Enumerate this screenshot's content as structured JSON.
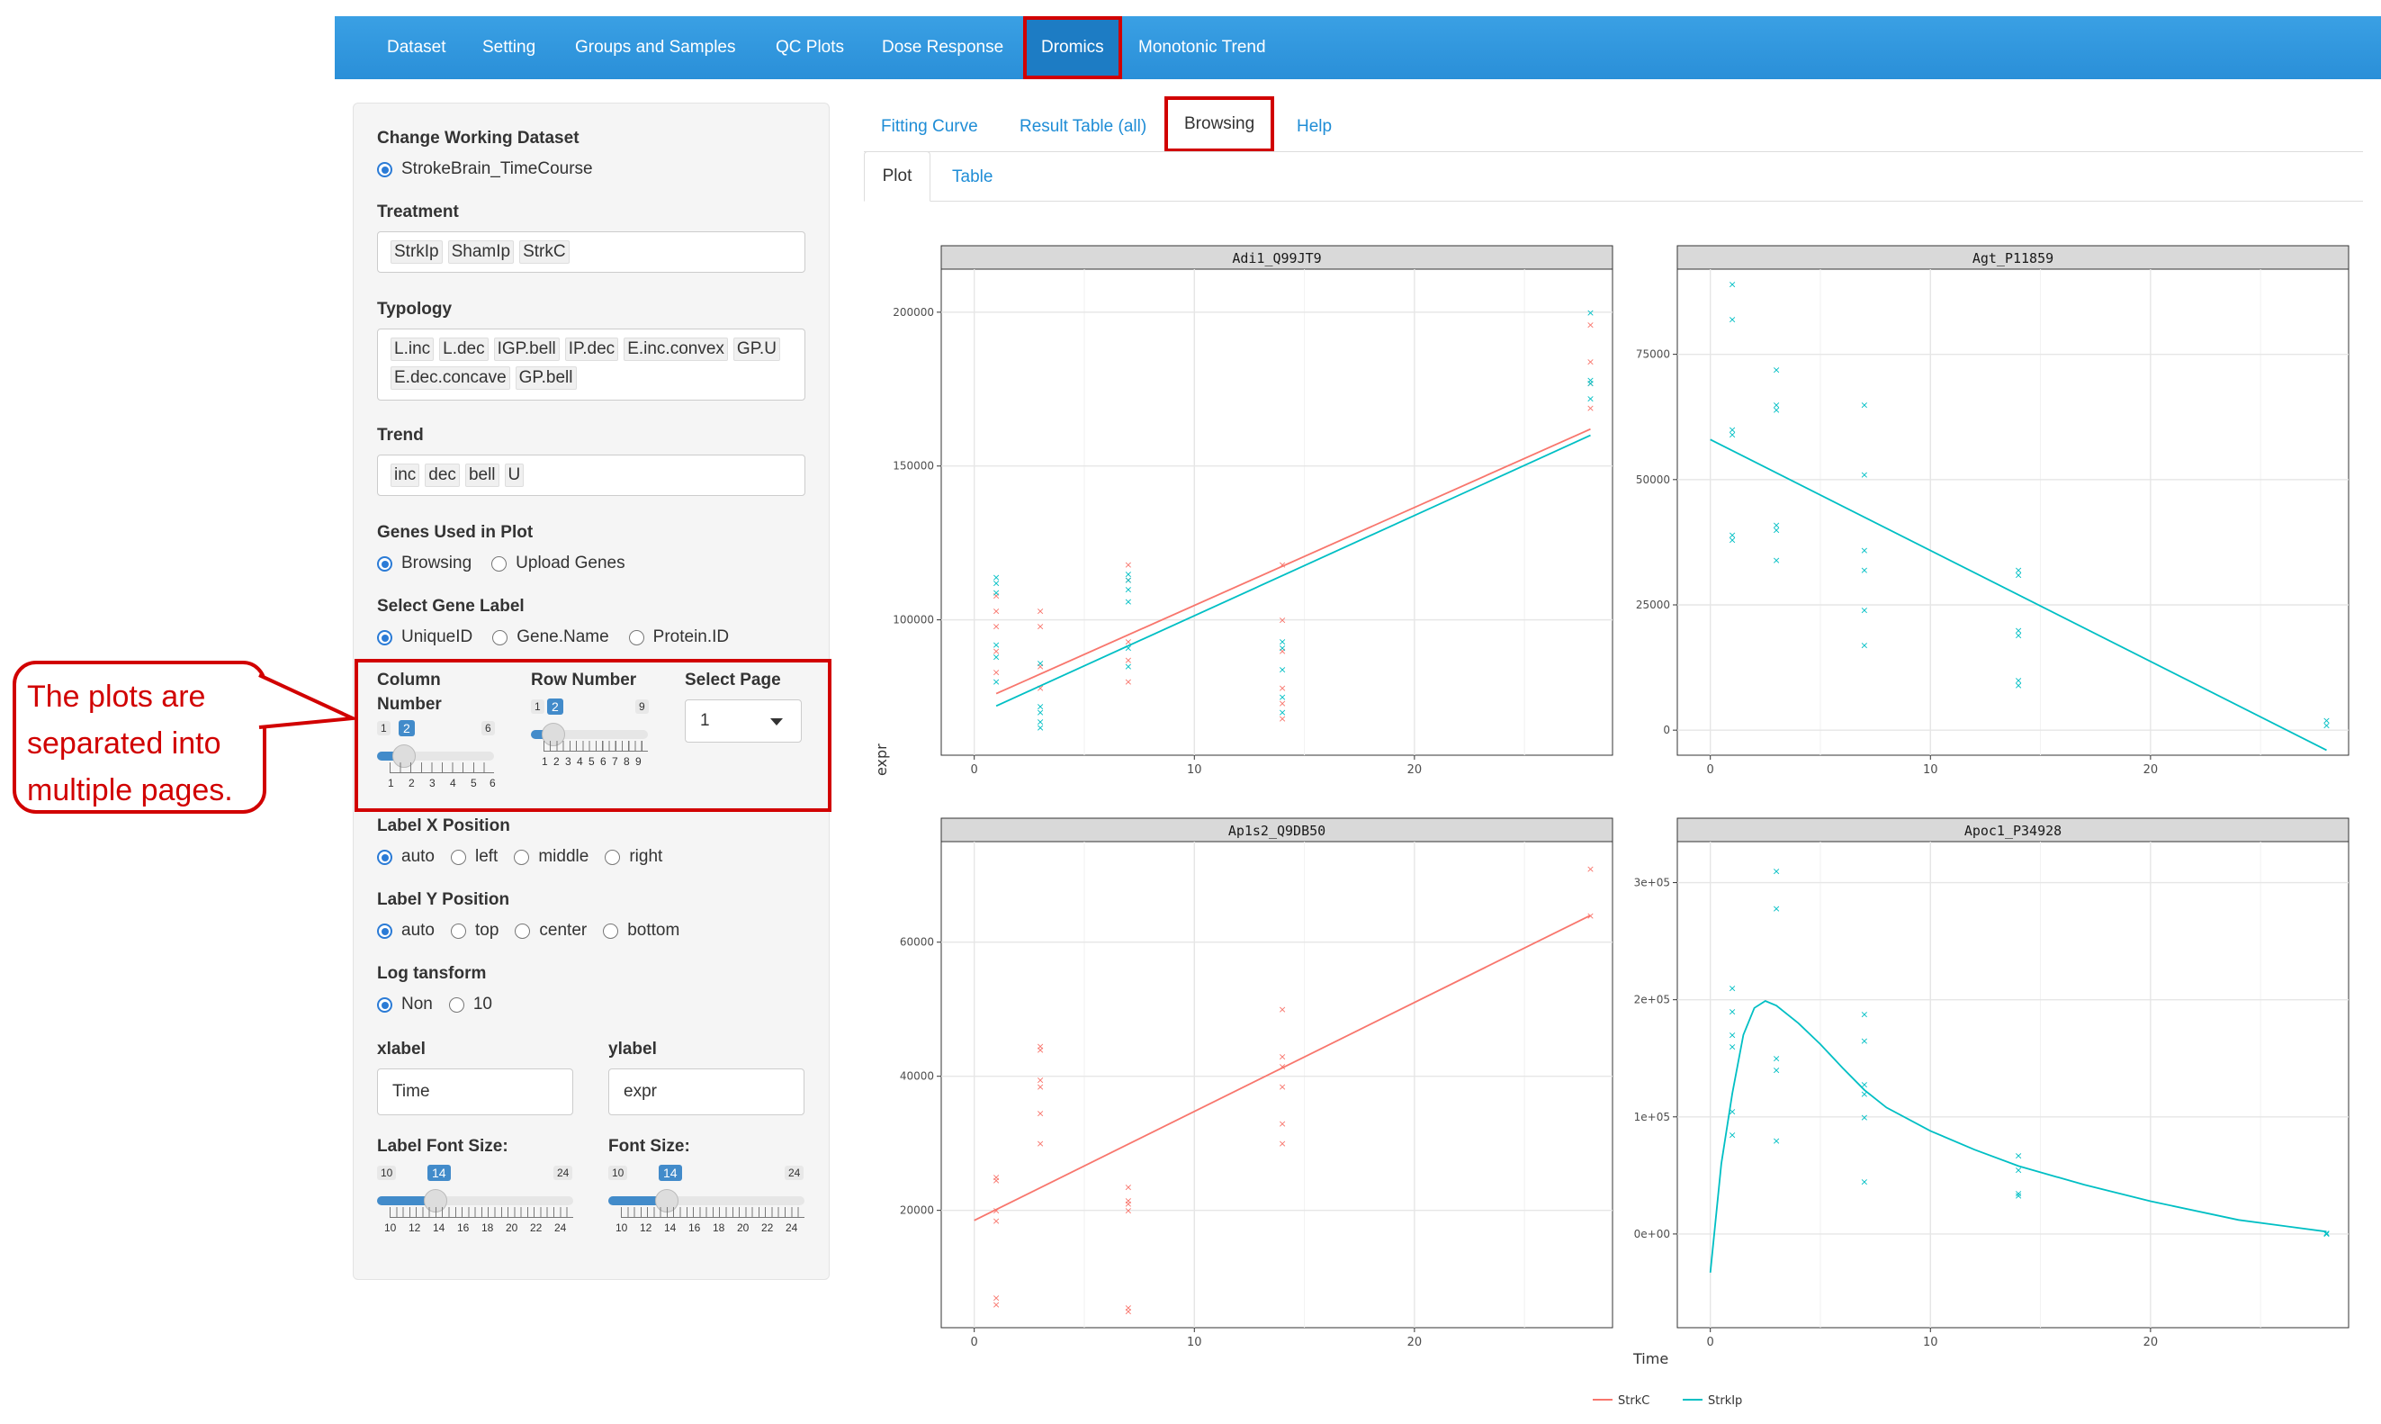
{
  "nav": {
    "items": [
      "Dataset",
      "Setting",
      "Groups and Samples",
      "QC Plots",
      "Dose Response",
      "Dromics",
      "Monotonic Trend"
    ],
    "active": "Dromics"
  },
  "sidebar": {
    "working_dataset": {
      "label": "Change Working Dataset",
      "option": "StrokeBrain_TimeCourse"
    },
    "treatment": {
      "label": "Treatment",
      "tags": [
        "StrkIp",
        "ShamIp",
        "StrkC"
      ]
    },
    "typology": {
      "label": "Typology",
      "tags": [
        "L.inc",
        "L.dec",
        "IGP.bell",
        "IP.dec",
        "E.inc.convex",
        "GP.U",
        "E.dec.concave",
        "GP.bell"
      ]
    },
    "trend": {
      "label": "Trend",
      "tags": [
        "inc",
        "dec",
        "bell",
        "U"
      ]
    },
    "genes_used": {
      "label": "Genes Used in Plot",
      "options": [
        "Browsing",
        "Upload Genes"
      ],
      "selected": "Browsing"
    },
    "gene_label": {
      "label": "Select Gene Label",
      "options": [
        "UniqueID",
        "Gene.Name",
        "Protein.ID"
      ],
      "selected": "UniqueID"
    },
    "column_number": {
      "label_line1": "Column",
      "label_line2": "Number",
      "min": "1",
      "max": "6",
      "value": "2",
      "ticks": [
        "1",
        "2",
        "3",
        "4",
        "5",
        "6"
      ]
    },
    "row_number": {
      "label": "Row Number",
      "min": "1",
      "max": "9",
      "value": "2",
      "ticks": [
        "1",
        "2",
        "3",
        "4",
        "5",
        "6",
        "7",
        "8",
        "9"
      ]
    },
    "select_page": {
      "label": "Select Page",
      "value": "1"
    },
    "label_x": {
      "label": "Label X Position",
      "options": [
        "auto",
        "left",
        "middle",
        "right"
      ],
      "selected": "auto"
    },
    "label_y": {
      "label": "Label Y Position",
      "options": [
        "auto",
        "top",
        "center",
        "bottom"
      ],
      "selected": "auto"
    },
    "log": {
      "label": "Log tansform",
      "options": [
        "Non",
        "10"
      ],
      "selected": "Non"
    },
    "xlabel": {
      "label": "xlabel",
      "value": "Time"
    },
    "ylabel": {
      "label": "ylabel",
      "value": "expr"
    },
    "label_font": {
      "label": "Label Font Size:",
      "min": "10",
      "max": "24",
      "value": "14",
      "ticks": [
        "10",
        "12",
        "14",
        "16",
        "18",
        "20",
        "22",
        "24"
      ]
    },
    "font_size": {
      "label": "Font Size:",
      "min": "10",
      "max": "24",
      "value": "14",
      "ticks": [
        "10",
        "12",
        "14",
        "16",
        "18",
        "20",
        "22",
        "24"
      ]
    }
  },
  "callout": {
    "text": [
      "The plots are",
      "separated into",
      "multiple pages."
    ]
  },
  "tabs": {
    "items": [
      "Fitting Curve",
      "Result Table (all)",
      "Browsing",
      "Help"
    ],
    "active": "Browsing"
  },
  "subtabs": {
    "items": [
      "Plot",
      "Table"
    ],
    "active": "Plot"
  },
  "chart_data": {
    "type": "scatter",
    "xlabel": "Time",
    "ylabel": "expr",
    "legend": {
      "placement": "bottom",
      "entries": [
        "StrkC",
        "StrkIp"
      ]
    },
    "colors": {
      "StrkC": "#f8766d",
      "StrkIp": "#00bfc4"
    },
    "x_ticks": [
      0,
      10,
      20
    ],
    "xlim": [
      -1.5,
      29
    ],
    "panels": [
      {
        "title": "Adi1_Q99JT9",
        "ylim": [
          56000,
          214000
        ],
        "y_ticks": [
          {
            "v": 100000,
            "l": "100000"
          },
          {
            "v": 150000,
            "l": "150000"
          },
          {
            "v": 200000,
            "l": "200000"
          }
        ],
        "series": [
          {
            "name": "StrkC",
            "points": [
              [
                1,
                83000
              ],
              [
                1,
                90000
              ],
              [
                1,
                98000
              ],
              [
                1,
                103000
              ],
              [
                1,
                108000
              ],
              [
                3,
                78000
              ],
              [
                3,
                85000
              ],
              [
                3,
                98000
              ],
              [
                3,
                103000
              ],
              [
                7,
                80000
              ],
              [
                7,
                87000
              ],
              [
                7,
                93000
              ],
              [
                7,
                113000
              ],
              [
                7,
                118000
              ],
              [
                14,
                68000
              ],
              [
                14,
                73000
              ],
              [
                14,
                78000
              ],
              [
                14,
                90000
              ],
              [
                14,
                100000
              ],
              [
                14,
                118000
              ],
              [
                28,
                169000
              ],
              [
                28,
                177000
              ],
              [
                28,
                184000
              ],
              [
                28,
                196000
              ]
            ],
            "fit": [
              [
                1,
                76000
              ],
              [
                28,
                162000
              ]
            ]
          },
          {
            "name": "StrkIp",
            "points": [
              [
                1,
                80000
              ],
              [
                1,
                88000
              ],
              [
                1,
                92000
              ],
              [
                1,
                109000
              ],
              [
                1,
                112000
              ],
              [
                1,
                114000
              ],
              [
                3,
                65000
              ],
              [
                3,
                67000
              ],
              [
                3,
                70000
              ],
              [
                3,
                72000
              ],
              [
                3,
                86000
              ],
              [
                7,
                85000
              ],
              [
                7,
                91000
              ],
              [
                7,
                106000
              ],
              [
                7,
                110000
              ],
              [
                7,
                113000
              ],
              [
                7,
                115000
              ],
              [
                14,
                70000
              ],
              [
                14,
                75000
              ],
              [
                14,
                84000
              ],
              [
                14,
                91000
              ],
              [
                14,
                93000
              ],
              [
                28,
                172000
              ],
              [
                28,
                177000
              ],
              [
                28,
                178000
              ],
              [
                28,
                200000
              ]
            ],
            "fit": [
              [
                1,
                72000
              ],
              [
                28,
                160000
              ]
            ]
          }
        ]
      },
      {
        "title": "Agt_P11859",
        "ylim": [
          -5000,
          92000
        ],
        "y_ticks": [
          {
            "v": 0,
            "l": "0"
          },
          {
            "v": 25000,
            "l": "25000"
          },
          {
            "v": 50000,
            "l": "50000"
          },
          {
            "v": 75000,
            "l": "75000"
          }
        ],
        "series": [
          {
            "name": "StrkIp",
            "points": [
              [
                1,
                89000
              ],
              [
                1,
                82000
              ],
              [
                1,
                60000
              ],
              [
                1,
                59000
              ],
              [
                1,
                39000
              ],
              [
                1,
                38000
              ],
              [
                3,
                72000
              ],
              [
                3,
                65000
              ],
              [
                3,
                64000
              ],
              [
                3,
                41000
              ],
              [
                3,
                40000
              ],
              [
                3,
                34000
              ],
              [
                7,
                65000
              ],
              [
                7,
                51000
              ],
              [
                7,
                36000
              ],
              [
                7,
                32000
              ],
              [
                7,
                24000
              ],
              [
                7,
                17000
              ],
              [
                14,
                32000
              ],
              [
                14,
                31000
              ],
              [
                14,
                20000
              ],
              [
                14,
                19000
              ],
              [
                14,
                10000
              ],
              [
                14,
                9000
              ],
              [
                28,
                2000
              ],
              [
                28,
                1000
              ]
            ],
            "fit": [
              [
                0,
                58000
              ],
              [
                28,
                -4000
              ]
            ]
          }
        ]
      },
      {
        "title": "Ap1s2_Q9DB50",
        "ylim": [
          2500,
          75000
        ],
        "y_ticks": [
          {
            "v": 20000,
            "l": "20000"
          },
          {
            "v": 40000,
            "l": "40000"
          },
          {
            "v": 60000,
            "l": "60000"
          }
        ],
        "series": [
          {
            "name": "StrkC",
            "points": [
              [
                1,
                25000
              ],
              [
                1,
                24500
              ],
              [
                1,
                20000
              ],
              [
                1,
                18500
              ],
              [
                1,
                7000
              ],
              [
                1,
                6000
              ],
              [
                3,
                44500
              ],
              [
                3,
                44000
              ],
              [
                3,
                39500
              ],
              [
                3,
                38500
              ],
              [
                3,
                34500
              ],
              [
                3,
                30000
              ],
              [
                7,
                23500
              ],
              [
                7,
                21500
              ],
              [
                7,
                21000
              ],
              [
                7,
                20000
              ],
              [
                7,
                5500
              ],
              [
                7,
                5000
              ],
              [
                14,
                50000
              ],
              [
                14,
                43000
              ],
              [
                14,
                41500
              ],
              [
                14,
                38500
              ],
              [
                14,
                33000
              ],
              [
                14,
                30000
              ],
              [
                28,
                71000
              ],
              [
                28,
                64000
              ]
            ],
            "fit": [
              [
                0,
                18500
              ],
              [
                28,
                64000
              ]
            ]
          }
        ]
      },
      {
        "title": "Apoc1_P34928",
        "ylim": [
          -80000,
          335000
        ],
        "y_ticks": [
          {
            "v": 0,
            "l": "0e+00"
          },
          {
            "v": 100000,
            "l": "1e+05"
          },
          {
            "v": 200000,
            "l": "2e+05"
          },
          {
            "v": 300000,
            "l": "3e+05"
          }
        ],
        "series": [
          {
            "name": "StrkIp",
            "points": [
              [
                1,
                210000
              ],
              [
                1,
                190000
              ],
              [
                1,
                170000
              ],
              [
                1,
                160000
              ],
              [
                1,
                105000
              ],
              [
                1,
                85000
              ],
              [
                3,
                310000
              ],
              [
                3,
                278000
              ],
              [
                3,
                150000
              ],
              [
                3,
                140000
              ],
              [
                3,
                80000
              ],
              [
                7,
                188000
              ],
              [
                7,
                165000
              ],
              [
                7,
                128000
              ],
              [
                7,
                120000
              ],
              [
                7,
                100000
              ],
              [
                7,
                45000
              ],
              [
                14,
                67000
              ],
              [
                14,
                55000
              ],
              [
                14,
                35000
              ],
              [
                14,
                33000
              ],
              [
                28,
                1000
              ],
              [
                28,
                500
              ]
            ],
            "fit": [
              [
                0,
                -33000
              ],
              [
                0.5,
                60000
              ],
              [
                1,
                120000
              ],
              [
                1.5,
                170000
              ],
              [
                2,
                193000
              ],
              [
                2.5,
                199000
              ],
              [
                3,
                195000
              ],
              [
                4,
                180000
              ],
              [
                5,
                162000
              ],
              [
                6,
                142000
              ],
              [
                7,
                123000
              ],
              [
                8,
                108000
              ],
              [
                10,
                88000
              ],
              [
                12,
                72000
              ],
              [
                14,
                58000
              ],
              [
                17,
                42000
              ],
              [
                20,
                28000
              ],
              [
                24,
                12000
              ],
              [
                28,
                2000
              ]
            ]
          }
        ]
      }
    ]
  }
}
